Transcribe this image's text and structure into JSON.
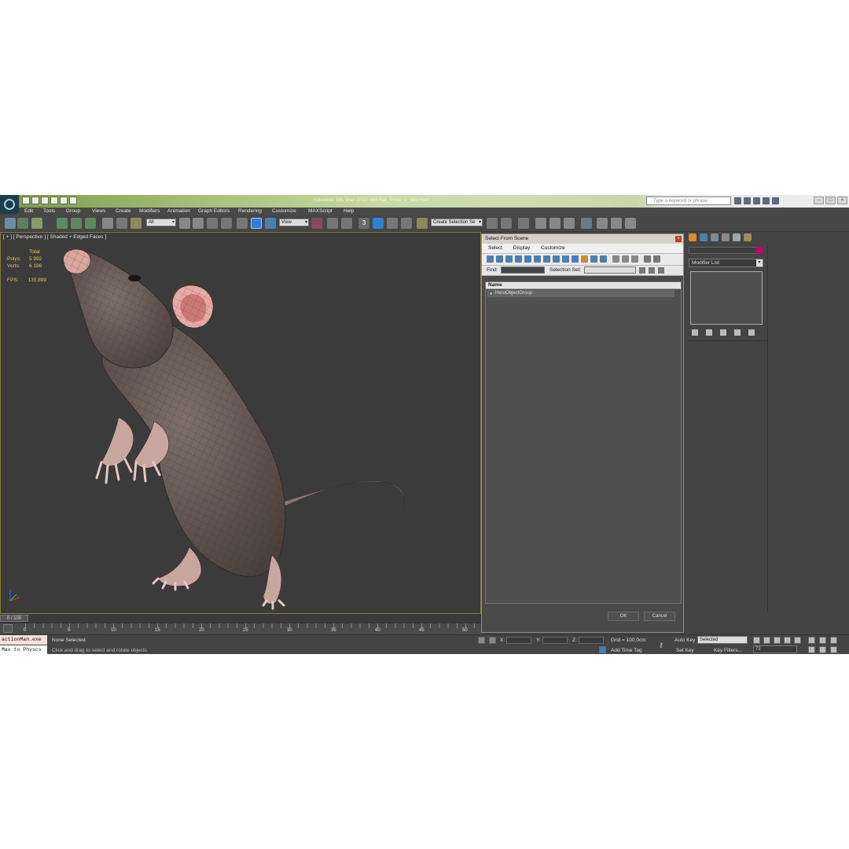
{
  "title_bar": {
    "app_title": "Autodesk 3ds Max  2012 x64     Rat_Pose_2_3ds.max",
    "search_placeholder": "Type a keyword or phrase"
  },
  "menu": [
    "Edit",
    "Tools",
    "Group",
    "Views",
    "Create",
    "Modifiers",
    "Animation",
    "Graph Editors",
    "Rendering",
    "Customize",
    "MAXScript",
    "Help"
  ],
  "toolbar": {
    "selection_filter": "All",
    "ref_coord": "View",
    "snap_number": "3",
    "named_selection": "Create Selection Se"
  },
  "viewport": {
    "label": "[ + ] [ Perspective ] [ Shaded + Edged Faces ]",
    "stats_header": "Total",
    "polys_label": "Polys:",
    "polys_value": "5 992",
    "verts_label": "Verts:",
    "verts_value": "6 186",
    "fps_label": "FPS:",
    "fps_value": "135,899"
  },
  "dialog": {
    "title": "Select From Scene",
    "menu": [
      "Select",
      "Display",
      "Customize"
    ],
    "find_label": "Find:",
    "selection_set_label": "Selection Set:",
    "column_header": "Name",
    "items": [
      "HeroObjectGroup"
    ],
    "ok_label": "OK",
    "cancel_label": "Cancel"
  },
  "command_panel": {
    "modifier_list": "Modifier List"
  },
  "timeline": {
    "frame_counter": "0 / 100",
    "ticks": [
      "0",
      "5",
      "10",
      "15",
      "20",
      "25",
      "30",
      "35",
      "40",
      "45",
      "50"
    ]
  },
  "status": {
    "listener_top": "actionMan.exe",
    "listener_bottom": "Max to Physcs",
    "selection_status": "None Selected",
    "prompt": "Click and drag to select and rotate objects",
    "x_label": "X:",
    "y_label": "Y:",
    "z_label": "Z:",
    "grid": "Grid = 100,0cm",
    "add_time_tag": "Add Time Tag",
    "auto_key": "Auto Key",
    "set_key": "Set Key",
    "key_mode": "Selected",
    "key_filters": "Key Filters...",
    "current_frame": "72"
  },
  "colors": {
    "title_green": "#7a9a4a",
    "viewport_bg": "#3b3b3b",
    "stats_yellow": "#e5c84a",
    "active_blue": "#2f7fd6",
    "object_color": "#c4006f"
  }
}
